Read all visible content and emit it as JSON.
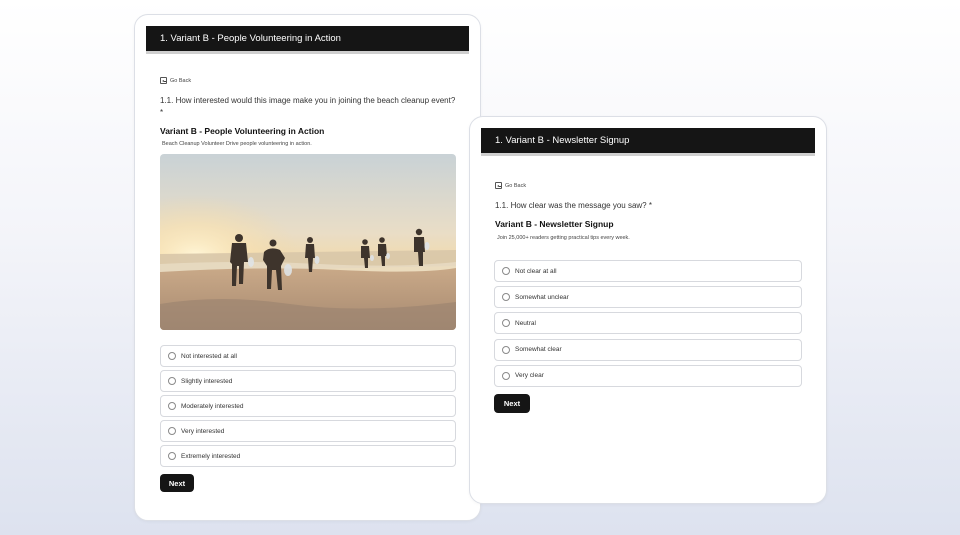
{
  "card_a": {
    "header": "1. Variant B - People Volunteering in Action",
    "go_back": "Go Back",
    "question": "1.1. How interested would this image make you in joining the beach cleanup event? *",
    "variant_title": "Variant B - People Volunteering in Action",
    "variant_desc": "Beach Cleanup Volunteer Drive people volunteering in action.",
    "options": [
      "Not interested at all",
      "Slightly interested",
      "Moderately interested",
      "Very interested",
      "Extremely interested"
    ],
    "next": "Next"
  },
  "card_b": {
    "header": "1. Variant B - Newsletter Signup",
    "go_back": "Go Back",
    "question": "1.1. How clear was the message you saw? *",
    "variant_title": "Variant B - Newsletter Signup",
    "variant_desc": "Join 25,000+ readers getting practical tips every week.",
    "options": [
      "Not clear at all",
      "Somewhat unclear",
      "Neutral",
      "Somewhat clear",
      "Very clear"
    ],
    "next": "Next"
  },
  "colors": {
    "header_bg": "#151515",
    "button_bg": "#151515",
    "card_bg": "#ffffff",
    "page_bg_bottom": "#dde2ef"
  },
  "icons": {
    "go_back": "arrow-left-box-icon",
    "option": "radio-circle-icon"
  }
}
